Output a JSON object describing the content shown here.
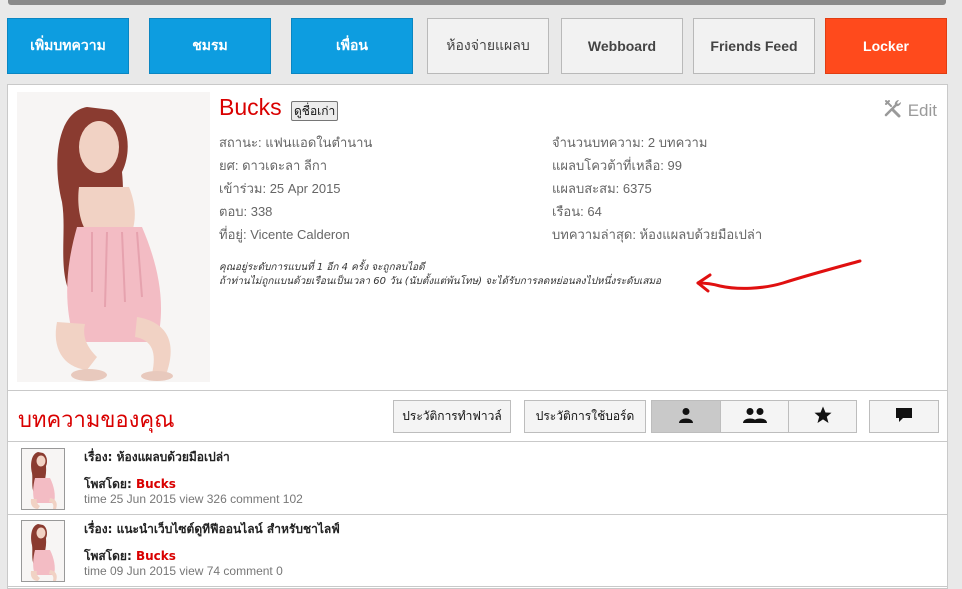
{
  "nav": {
    "items": [
      {
        "label": "เพิ่มบทความ"
      },
      {
        "label": "ชมรม"
      },
      {
        "label": "เพื่อน"
      },
      {
        "label": "ห้องจ่ายแผลบ"
      },
      {
        "label": "Webboard"
      },
      {
        "label": "Friends Feed"
      },
      {
        "label": "Locker"
      }
    ]
  },
  "colors": {
    "accent_blue": "#0d9de0",
    "accent_red": "#ff4a1c",
    "name_red": "#d90000",
    "annotation_red": "#e01010"
  },
  "profile": {
    "username": "Bucks",
    "old_look_label": "ดูชื่อเก่า",
    "edit_label": "Edit",
    "edit_icon": "tools-icon",
    "left": [
      "สถานะ: แฟนแอดในตำนาน",
      "ยศ: ดาวเดะลา ลีกา",
      "เข้าร่วม: 25 Apr 2015",
      "ตอบ: 338",
      "ที่อยู่: Vicente Calderon"
    ],
    "right": [
      "จำนวนบทความ: 2 บทความ",
      "แผลบโควต้าที่เหลือ: 99",
      "แผลบสะสม: 6375",
      "เรือน: 64",
      "บทความล่าสุด: ห้องแผลบด้วยมือเปล่า"
    ],
    "note_line1": "คุณอยู่ระดับการแบนที่ 1 อีก 4 ครั้ง จะถูกลบไอดี",
    "note_line2": "ถ้าท่านไม่ถูกแบนด้วยเรือนเป็นเวลา 60 วัน (นับตั้งแต่พ้นโทษ) จะได้รับการลดหย่อนลงไปหนึ่งระดับเสมอ"
  },
  "articles": {
    "title": "บทความของคุณ",
    "tab_fav": "ประวัติการทำฟาวล์",
    "tab_board": "ประวัติการใช้บอร์ด",
    "view_icons": [
      "user-icon",
      "group-icon",
      "star-icon"
    ],
    "chat_icon": "chat-icon",
    "by_label": "โพสโดย:",
    "items": [
      {
        "subject": "เรื่อง: ห้องแผลบด้วยมือเปล่า",
        "author": "Bucks",
        "meta": "time 25 Jun 2015 view 326 comment 102"
      },
      {
        "subject": "เรื่อง: แนะนำเว็บไซต์ดูทีฟีออนไลน์ สำหรับชาไลฟ์",
        "author": "Bucks",
        "meta": "time 09 Jun 2015 view 74 comment 0"
      }
    ]
  }
}
